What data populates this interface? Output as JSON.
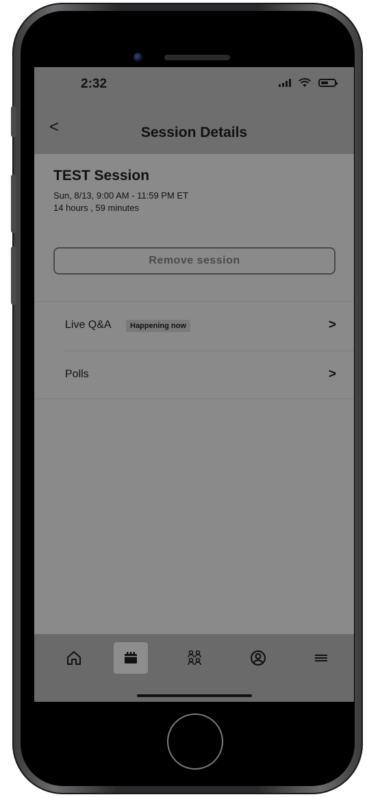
{
  "status_bar": {
    "time": "2:32"
  },
  "nav": {
    "back_label": "<",
    "title": "Session Details"
  },
  "session": {
    "title": "TEST Session",
    "date": "Sun, 8/13, 9:00 AM - 11:59 PM ET",
    "duration": "14 hours , 59 minutes",
    "remove_label": "Remove session"
  },
  "rows": [
    {
      "label": "Live Q&A",
      "badge": "Happening now"
    },
    {
      "label": "Polls"
    }
  ],
  "tabbar": {
    "items": [
      {
        "icon": "home-icon",
        "active": false
      },
      {
        "icon": "calendar-icon",
        "active": true
      },
      {
        "icon": "people-icon",
        "active": false
      },
      {
        "icon": "profile-icon",
        "active": false
      },
      {
        "icon": "menu-icon",
        "active": false
      }
    ]
  },
  "colors": {
    "screen_bg": "#8a8a8a",
    "bar_bg": "#6e6e6e",
    "text": "#111111"
  }
}
